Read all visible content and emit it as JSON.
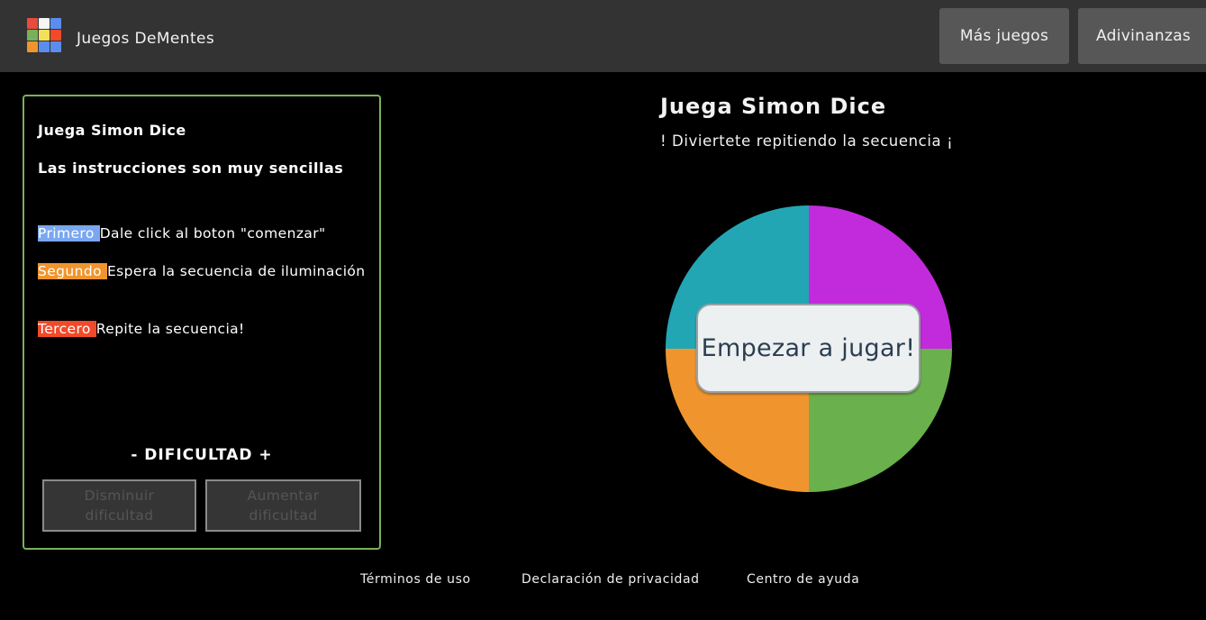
{
  "header": {
    "brand": "Juegos DeMentes",
    "logo_colors": [
      "#e74c3c",
      "#f5f5f5",
      "#5b8def",
      "#79b15a",
      "#f1e05a",
      "#f04a2a",
      "#f0952e",
      "#5b8def",
      "#5b8def"
    ],
    "nav": [
      "Más juegos",
      "Adivinanzas"
    ]
  },
  "instructions": {
    "title": "Juega Simon Dice",
    "subtitle": "Las instrucciones son muy sencillas",
    "steps": [
      {
        "tag": "Primero",
        "text": "Dale click al boton \"comenzar\"",
        "color": "#7aa7f0"
      },
      {
        "tag": "Segundo",
        "text": "Espera la secuencia de iluminación",
        "color": "#f0952e"
      },
      {
        "tag": "Tercero",
        "text": "Repite la secuencia!",
        "color": "#f04a2a"
      }
    ],
    "difficulty_label": "- DIFICULTAD +",
    "decrease_label": "Disminuir dificultad",
    "increase_label": "Aumentar dificultad"
  },
  "game": {
    "title": "Juega Simon Dice",
    "subtitle": "! Diviertete repitiendo la secuencia ¡",
    "start_label": "Empezar a jugar!",
    "quadrant_colors": {
      "top_left": "#22a6b3",
      "top_right": "#c22bdb",
      "bottom_left": "#f0952e",
      "bottom_right": "#6ab04c"
    }
  },
  "footer": {
    "links": [
      "Términos de uso",
      "Declaración de privacidad",
      "Centro de ayuda"
    ]
  }
}
